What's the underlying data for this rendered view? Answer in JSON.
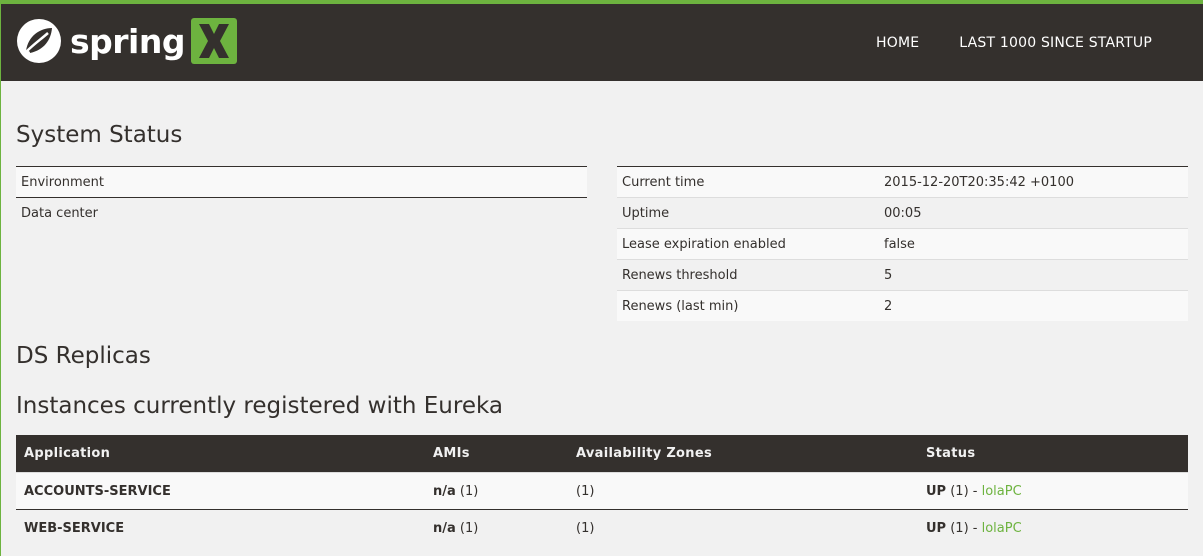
{
  "brand": {
    "name": "spring"
  },
  "nav": {
    "home": "HOME",
    "last": "LAST 1000 SINCE STARTUP"
  },
  "headings": {
    "system_status": "System Status",
    "ds_replicas": "DS Replicas",
    "instances": "Instances currently registered with Eureka"
  },
  "system_left": [
    {
      "label": "Environment",
      "value": ""
    },
    {
      "label": "Data center",
      "value": ""
    }
  ],
  "system_right": [
    {
      "label": "Current time",
      "value": "2015-12-20T20:35:42 +0100"
    },
    {
      "label": "Uptime",
      "value": "00:05"
    },
    {
      "label": "Lease expiration enabled",
      "value": "false"
    },
    {
      "label": "Renews threshold",
      "value": "5"
    },
    {
      "label": "Renews (last min)",
      "value": "2"
    }
  ],
  "instances_table": {
    "headers": [
      "Application",
      "AMIs",
      "Availability Zones",
      "Status"
    ],
    "rows": [
      {
        "application": "ACCOUNTS-SERVICE",
        "ami": "n/a",
        "ami_count": " (1)",
        "zones": "(1)",
        "status": "UP",
        "status_count": " (1) - ",
        "instance": "lolaPC"
      },
      {
        "application": "WEB-SERVICE",
        "ami": "n/a",
        "ami_count": " (1)",
        "zones": "(1)",
        "status": "UP",
        "status_count": " (1) - ",
        "instance": "lolaPC"
      }
    ]
  },
  "colors": {
    "accent": "#6db33f",
    "dark": "#34302d",
    "background": "#f1f1f1"
  }
}
